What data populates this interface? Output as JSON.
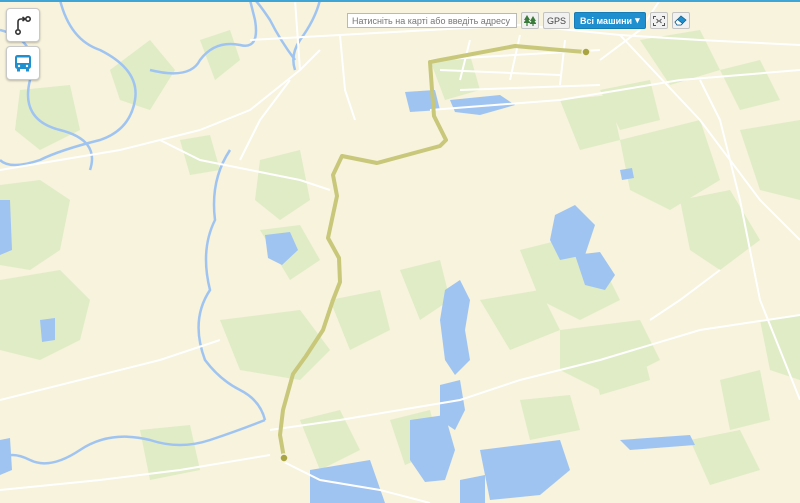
{
  "search": {
    "placeholder": "Натисніть на карті або введіть адресу"
  },
  "toolbar": {
    "gps_label": "GPS",
    "vehicles_dropdown": {
      "selected": "Всі машини",
      "arrow": "▾"
    }
  },
  "icons": {
    "route": "route-icon",
    "bus": "bus-icon",
    "trees": "trees-icon",
    "fit_bounds": "fit-bounds-icon",
    "eraser": "eraser-icon"
  },
  "colors": {
    "land": "#f7f3dc",
    "forest": "#e0ecc6",
    "water": "#9fc4f2",
    "river": "#9fc4f2",
    "road": "#ffffff",
    "route": "#c8c77a",
    "marker": "#a7a441",
    "accent": "#1f8fcf"
  }
}
